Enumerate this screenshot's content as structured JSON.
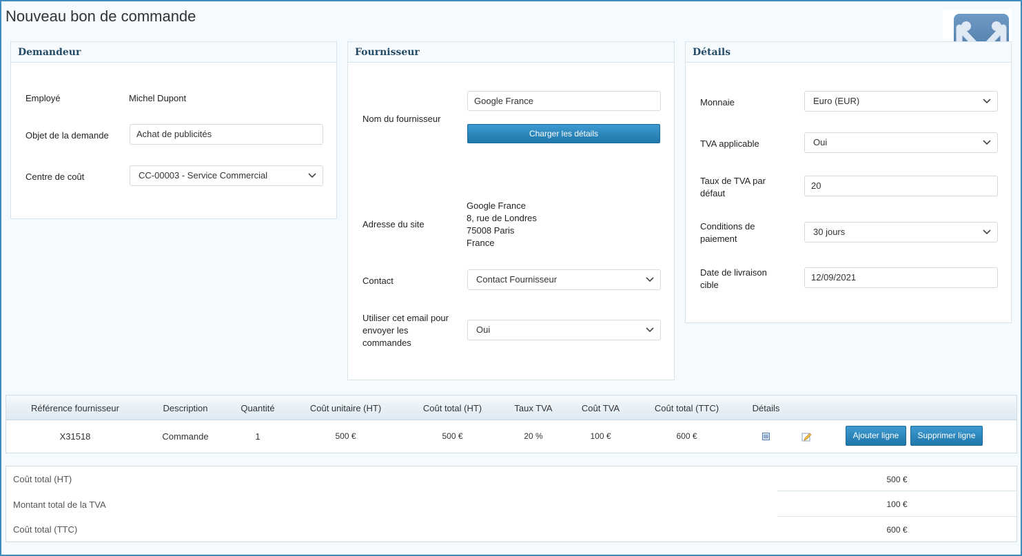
{
  "page": {
    "title": "Nouveau bon de commande"
  },
  "demandeur": {
    "heading": "Demandeur",
    "employee_label": "Employé",
    "employee_value": "Michel Dupont",
    "object_label": "Objet de la demande",
    "object_value": "Achat de publicités",
    "cost_center_label": "Centre de coût",
    "cost_center_value": "CC-00003 - Service Commercial"
  },
  "fournisseur": {
    "heading": "Fournisseur",
    "name_label": "Nom du fournisseur",
    "name_value": "Google France",
    "load_button": "Charger les détails",
    "address_label": "Adresse du site",
    "address_lines": [
      "Google France",
      "8, rue de Londres",
      "75008 Paris",
      "France"
    ],
    "contact_label": "Contact",
    "contact_value": "Contact Fournisseur",
    "email_label": "Utiliser cet email pour envoyer les commandes",
    "email_value": "Oui"
  },
  "details": {
    "heading": "Détails",
    "currency_label": "Monnaie",
    "currency_value": "Euro (EUR)",
    "vat_label": "TVA applicable",
    "vat_value": "Oui",
    "vat_rate_label": "Taux de TVA par défaut",
    "vat_rate_value": "20",
    "payment_label": "Conditions de paiement",
    "payment_value": "30 jours",
    "delivery_label": "Date de livraison cible",
    "delivery_value": "12/09/2021"
  },
  "lines": {
    "headers": [
      "Référence fournisseur",
      "Description",
      "Quantité",
      "Coût unitaire (HT)",
      "Coût total (HT)",
      "Taux TVA",
      "Coût TVA",
      "Coût total (TTC)",
      "Détails"
    ],
    "rows": [
      [
        "X31518",
        "Commande",
        "1",
        "500 €",
        "500 €",
        "20 %",
        "100 €",
        "600 €"
      ]
    ],
    "add_button": "Ajouter ligne",
    "delete_button": "Supprimer ligne"
  },
  "totals": [
    {
      "label": "Coût total (HT)",
      "value": "500 €"
    },
    {
      "label": "Montant total de la TVA",
      "value": "100 €"
    },
    {
      "label": "Coût total (TTC)",
      "value": "600 €"
    }
  ],
  "colors": {
    "accent": "#1f77aa",
    "heading": "#244b66",
    "border": "#3a8cc0"
  },
  "icons": [
    "chevron-down-icon",
    "details-icon",
    "edit-icon",
    "logo-icon"
  ]
}
